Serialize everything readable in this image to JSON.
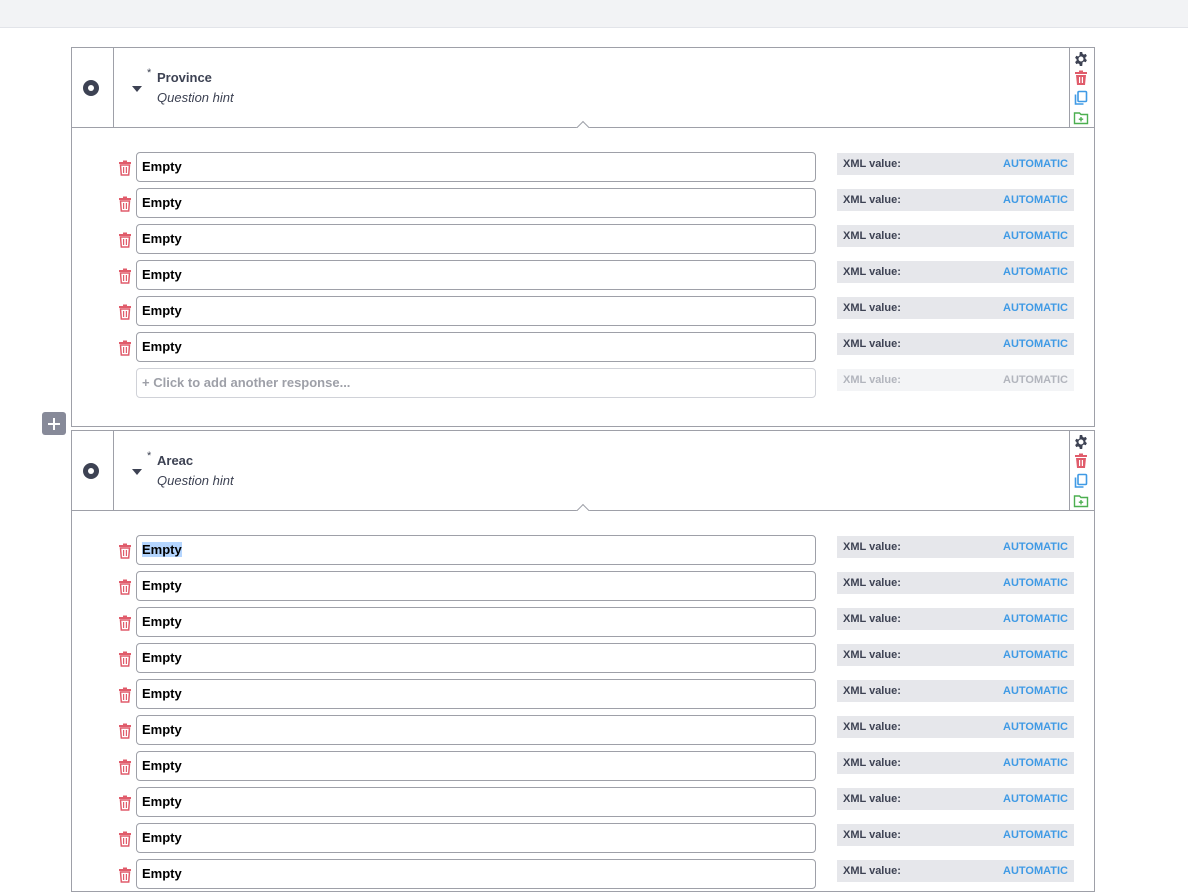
{
  "colors": {
    "accent": "#3f9ae5",
    "danger": "#e05c6b",
    "text": "#3d4253",
    "border": "#9ea0a8",
    "add": "#4caf50"
  },
  "icons": {
    "question_type": "radio-icon",
    "collapse": "caret-down-icon",
    "settings": "gear-icon",
    "delete": "trash-icon",
    "duplicate": "copy-icon",
    "add_to_library": "folder-plus-icon",
    "add_question": "plus-icon"
  },
  "questions": [
    {
      "required_mark": "*",
      "label": "Province",
      "hint": "Question hint",
      "options": [
        {
          "label": "Empty",
          "xml_label": "XML value:",
          "xml_value": "AUTOMATIC"
        },
        {
          "label": "Empty",
          "xml_label": "XML value:",
          "xml_value": "AUTOMATIC"
        },
        {
          "label": "Empty",
          "xml_label": "XML value:",
          "xml_value": "AUTOMATIC"
        },
        {
          "label": "Empty",
          "xml_label": "XML value:",
          "xml_value": "AUTOMATIC"
        },
        {
          "label": "Empty",
          "xml_label": "XML value:",
          "xml_value": "AUTOMATIC"
        },
        {
          "label": "Empty",
          "xml_label": "XML value:",
          "xml_value": "AUTOMATIC"
        }
      ],
      "add_response": {
        "placeholder": "+ Click to add another response...",
        "xml_label": "XML value:",
        "xml_value": "AUTOMATIC"
      }
    },
    {
      "required_mark": "*",
      "label": "Areac",
      "hint": "Question hint",
      "options": [
        {
          "label": "Empty",
          "xml_label": "XML value:",
          "xml_value": "AUTOMATIC",
          "selected": true
        },
        {
          "label": "Empty",
          "xml_label": "XML value:",
          "xml_value": "AUTOMATIC"
        },
        {
          "label": "Empty",
          "xml_label": "XML value:",
          "xml_value": "AUTOMATIC"
        },
        {
          "label": "Empty",
          "xml_label": "XML value:",
          "xml_value": "AUTOMATIC"
        },
        {
          "label": "Empty",
          "xml_label": "XML value:",
          "xml_value": "AUTOMATIC"
        },
        {
          "label": "Empty",
          "xml_label": "XML value:",
          "xml_value": "AUTOMATIC"
        },
        {
          "label": "Empty",
          "xml_label": "XML value:",
          "xml_value": "AUTOMATIC"
        },
        {
          "label": "Empty",
          "xml_label": "XML value:",
          "xml_value": "AUTOMATIC"
        },
        {
          "label": "Empty",
          "xml_label": "XML value:",
          "xml_value": "AUTOMATIC"
        },
        {
          "label": "Empty",
          "xml_label": "XML value:",
          "xml_value": "AUTOMATIC"
        }
      ]
    }
  ]
}
